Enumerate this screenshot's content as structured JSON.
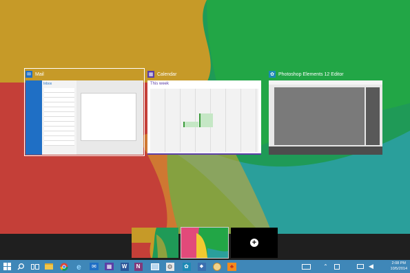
{
  "windows": {
    "mail": {
      "title": "Mail",
      "inbox_label": "Inbox"
    },
    "calendar": {
      "title": "Calendar",
      "week_label": "This week"
    },
    "photoshop": {
      "title": "Photoshop Elements 12 Editor"
    }
  },
  "desktops": {
    "new_desktop_icon": "plus-icon"
  },
  "taskbar": {
    "icons": [
      "windows-logo-icon",
      "search-icon",
      "task-view-icon",
      "file-explorer-icon",
      "chrome-icon",
      "internet-explorer-icon",
      "mail-icon",
      "calendar-icon",
      "word-icon",
      "onenote-icon",
      "photos-icon",
      "settings-icon",
      "store-icon",
      "photoshop-icon",
      "paint-icon",
      "games-icon"
    ],
    "tray_icons": [
      "keyboard-icon",
      "chevron-up-icon",
      "notification-icon",
      "network-icon",
      "volume-icon"
    ]
  },
  "clock": {
    "time": "2:08 PM",
    "date": "10/5/2014"
  },
  "colors": {
    "accent": "#3f87b8",
    "mail_blue": "#1f6fc5",
    "calendar_purple": "#5b3ea6",
    "desktop_green": "#1f9a57"
  }
}
